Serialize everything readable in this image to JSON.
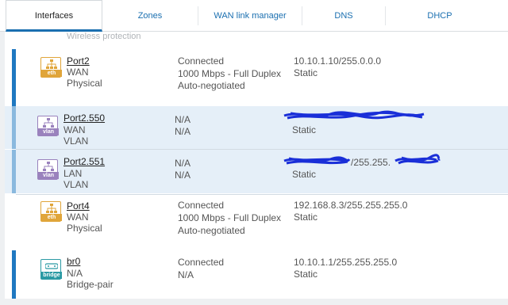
{
  "tabs": [
    {
      "label": "Interfaces",
      "active": true
    },
    {
      "label": "Zones"
    },
    {
      "label": "WAN link manager"
    },
    {
      "label": "DNS"
    },
    {
      "label": "DHCP"
    }
  ],
  "faded_header": "Wireless protection",
  "interfaces": [
    {
      "name": "Port2",
      "zone": "WAN",
      "type": "Physical",
      "icon": "eth",
      "status": [
        "Connected",
        "1000 Mbps - Full Duplex",
        "Auto-negotiated"
      ],
      "ip": "10.10.1.10/255.0.0.0",
      "ip_mode": "Static"
    },
    {
      "name": "Port2.550",
      "zone": "WAN",
      "type": "VLAN",
      "icon": "vlan",
      "status": [
        "N/A",
        "N/A"
      ],
      "ip": "",
      "ip_mode": "Static"
    },
    {
      "name": "Port2.551",
      "zone": "LAN",
      "type": "VLAN",
      "icon": "vlan",
      "status": [
        "N/A",
        "N/A"
      ],
      "ip": "/255.255.",
      "ip_mode": "Static"
    },
    {
      "name": "Port4",
      "zone": "WAN",
      "type": "Physical",
      "icon": "eth",
      "status": [
        "Connected",
        "1000 Mbps - Full Duplex",
        "Auto-negotiated"
      ],
      "ip": "192.168.8.3/255.255.255.0",
      "ip_mode": "Static"
    },
    {
      "name": "br0",
      "zone": "N/A",
      "type": "Bridge-pair",
      "icon": "bridge",
      "status": [
        "Connected",
        "N/A"
      ],
      "ip": "10.10.1.1/255.255.255.0",
      "ip_mode": "Static"
    }
  ],
  "colors": {
    "accent": "#1f78c1",
    "eth": "#e0a53a",
    "vlan": "#9a82bd",
    "bridge": "#2b9aa4",
    "redaction": "#1a2fd8"
  }
}
